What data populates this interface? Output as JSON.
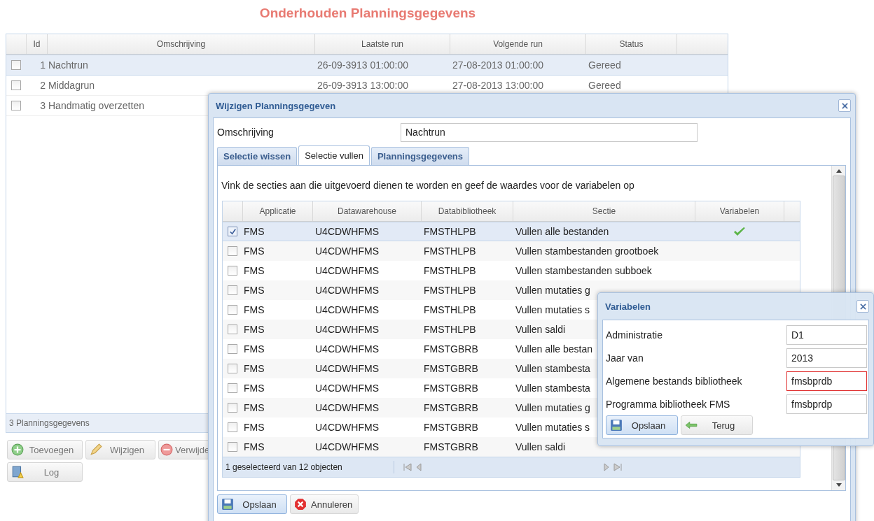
{
  "page_title": "Onderhouden Planningsgegevens",
  "grid": {
    "columns": [
      "Id",
      "Omschrijving",
      "Laatste run",
      "Volgende run",
      "Status"
    ],
    "rows": [
      {
        "id": "1",
        "description": "Nachtrun",
        "last_run": "26-09-3913 01:00:00",
        "next_run": "27-08-2013 01:00:00",
        "status": "Gereed",
        "selected": true,
        "checked": false
      },
      {
        "id": "2",
        "description": "Middagrun",
        "last_run": "26-09-3913 13:00:00",
        "next_run": "27-08-2013 13:00:00",
        "status": "Gereed",
        "selected": false,
        "checked": false
      },
      {
        "id": "3",
        "description": "Handmatig overzetten",
        "selected": false,
        "checked": false
      }
    ],
    "footer": "3 Planningsgegevens"
  },
  "buttons": [
    {
      "label": "Toevoegen"
    },
    {
      "label": "Wijzigen"
    },
    {
      "label": "Verwijde"
    },
    {
      "label": "Log"
    }
  ],
  "dialog": {
    "title": "Wijzigen Planningsgegeven",
    "field_label": "Omschrijving",
    "field_value": "Nachtrun",
    "tabs": [
      {
        "label": "Selectie wissen",
        "selected": false
      },
      {
        "label": "Selectie vullen",
        "selected": true
      },
      {
        "label": "Planningsgegevens",
        "selected": false
      }
    ],
    "instruction": "Vink de secties aan die uitgevoerd dienen te worden en geef de waardes voor de variabelen op",
    "columns": [
      "Applicatie",
      "Datawarehouse",
      "Databibliotheek",
      "Sectie",
      "Variabelen"
    ],
    "rows": [
      {
        "application": "FMS",
        "warehouse": "U4CDWHFMS",
        "library": "FMSTHLPB",
        "section": "Vullen alle bestanden",
        "checked": true,
        "selected": true,
        "variables": true
      },
      {
        "application": "FMS",
        "warehouse": "U4CDWHFMS",
        "library": "FMSTHLPB",
        "section": "Vullen stambestanden grootboek",
        "checked": false,
        "selected": false,
        "variables": false
      },
      {
        "application": "FMS",
        "warehouse": "U4CDWHFMS",
        "library": "FMSTHLPB",
        "section": "Vullen stambestanden subboek",
        "checked": false,
        "selected": false,
        "variables": false
      },
      {
        "application": "FMS",
        "warehouse": "U4CDWHFMS",
        "library": "FMSTHLPB",
        "section": "Vullen mutaties g",
        "checked": false,
        "selected": false,
        "variables": false
      },
      {
        "application": "FMS",
        "warehouse": "U4CDWHFMS",
        "library": "FMSTHLPB",
        "section": "Vullen mutaties s",
        "checked": false,
        "selected": false,
        "variables": false
      },
      {
        "application": "FMS",
        "warehouse": "U4CDWHFMS",
        "library": "FMSTHLPB",
        "section": "Vullen saldi",
        "checked": false,
        "selected": false,
        "variables": false
      },
      {
        "application": "FMS",
        "warehouse": "U4CDWHFMS",
        "library": "FMSTGBRB",
        "section": "Vullen alle bestan",
        "checked": false,
        "selected": false,
        "variables": false
      },
      {
        "application": "FMS",
        "warehouse": "U4CDWHFMS",
        "library": "FMSTGBRB",
        "section": "Vullen stambesta",
        "checked": false,
        "selected": false,
        "variables": false
      },
      {
        "application": "FMS",
        "warehouse": "U4CDWHFMS",
        "library": "FMSTGBRB",
        "section": "Vullen stambesta",
        "checked": false,
        "selected": false,
        "variables": false
      },
      {
        "application": "FMS",
        "warehouse": "U4CDWHFMS",
        "library": "FMSTGBRB",
        "section": "Vullen mutaties g",
        "checked": false,
        "selected": false,
        "variables": false
      },
      {
        "application": "FMS",
        "warehouse": "U4CDWHFMS",
        "library": "FMSTGBRB",
        "section": "Vullen mutaties s",
        "checked": false,
        "selected": false,
        "variables": false
      },
      {
        "application": "FMS",
        "warehouse": "U4CDWHFMS",
        "library": "FMSTGBRB",
        "section": "Vullen saldi",
        "checked": false,
        "selected": false,
        "variables": false
      }
    ],
    "paging": "1 geselecteerd van 12 objecten",
    "buttons": [
      {
        "label": "Opslaan",
        "highlighted": true
      },
      {
        "label": "Annuleren",
        "highlighted": false
      }
    ]
  },
  "popup": {
    "title": "Variabelen",
    "fields": [
      {
        "label": "Administratie",
        "value": "D1",
        "invalid": false
      },
      {
        "label": "Jaar van",
        "value": "2013",
        "invalid": false
      },
      {
        "label": "Algemene bestands bibliotheek",
        "value": "fmsbprdb",
        "invalid": true
      },
      {
        "label": "Programma bibliotheek FMS",
        "value": "fmsbprdp",
        "invalid": false
      }
    ],
    "buttons": [
      {
        "label": "Opslaan",
        "highlighted": true
      },
      {
        "label": "Terug",
        "highlighted": false
      }
    ]
  }
}
